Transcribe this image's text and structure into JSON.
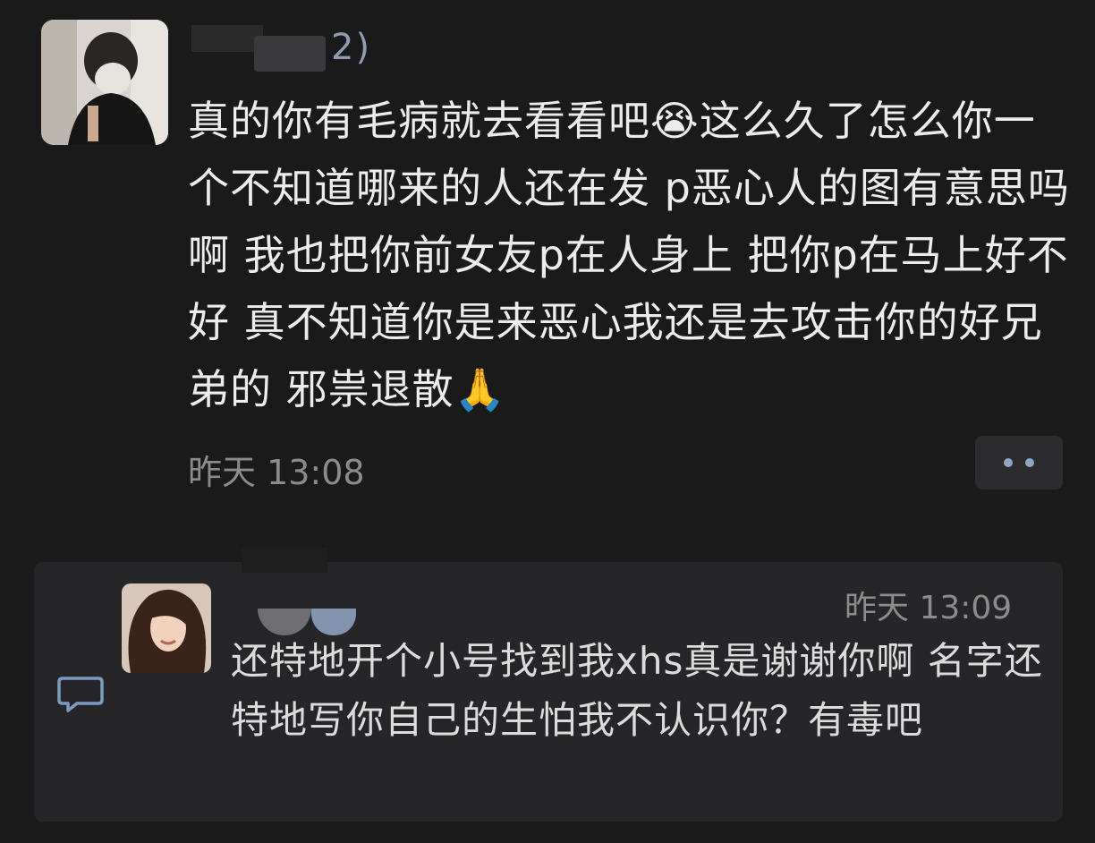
{
  "comment": {
    "name_suffix": "2)",
    "text": "真的你有毛病就去看看吧😭这么久了怎么你一个不知道哪来的人还在发 p恶心人的图有意思吗啊 我也把你前女友p在人身上 把你p在马上好不好 真不知道你是来恶心我还是去攻击你的好兄弟的 邪祟退散🙏",
    "time": "昨天 13:08",
    "more_icon": "more-dots-icon"
  },
  "reply": {
    "time": "昨天 13:09",
    "text": "还特地开个小号找到我xhs真是谢谢你啊 名字还特地写你自己的生怕我不认识你？有毒吧",
    "bubble_icon": "comment-bubble-icon"
  },
  "colors": {
    "background": "#1a1a1a",
    "card": "#262628",
    "text": "#ececec",
    "muted": "#8c8c8c",
    "accent": "#8fa6c5"
  }
}
